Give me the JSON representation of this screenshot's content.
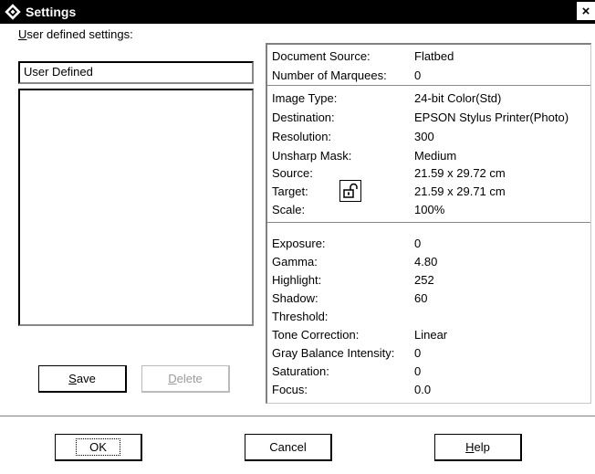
{
  "window": {
    "title": "Settings"
  },
  "left": {
    "label_prefix": "",
    "label_accel": "U",
    "label_rest": "ser defined settings:",
    "current_name": "User Defined",
    "save_accel": "S",
    "save_rest": "ave",
    "delete_accel": "D",
    "delete_rest": "elete"
  },
  "section1": [
    {
      "key": "Document Source:",
      "value": "Flatbed"
    },
    {
      "key": "Number of Marquees:",
      "value": "0"
    }
  ],
  "section2": [
    {
      "key": "Image Type:",
      "value": "24-bit Color(Std)"
    },
    {
      "key": "Destination:",
      "value": "EPSON Stylus Printer(Photo)"
    },
    {
      "key": "Resolution:",
      "value": "300"
    },
    {
      "key": "Unsharp Mask:",
      "value": "Medium"
    },
    {
      "key": "Source:",
      "value": "21.59 x 29.72 cm"
    },
    {
      "key": "Target:",
      "value": "21.59 x 29.71 cm"
    },
    {
      "key": "Scale:",
      "value": "100%"
    }
  ],
  "section3": [
    {
      "key": "Exposure:",
      "value": "0"
    },
    {
      "key": "Gamma:",
      "value": "4.80"
    },
    {
      "key": "Highlight:",
      "value": "252"
    },
    {
      "key": "Shadow:",
      "value": "60"
    },
    {
      "key": "Threshold:",
      "value": ""
    },
    {
      "key": "Tone Correction:",
      "value": "Linear"
    },
    {
      "key": "Gray Balance Intensity:",
      "value": "0"
    },
    {
      "key": "Saturation:",
      "value": "0"
    },
    {
      "key": "Focus:",
      "value": "0.0"
    }
  ],
  "footer": {
    "ok_label": "OK",
    "cancel_label": "Cancel",
    "help_accel": "H",
    "help_rest": "elp"
  },
  "icons": {
    "app": "scanner-diamond-icon",
    "lock": "lock-open-icon",
    "close": "close-icon"
  }
}
